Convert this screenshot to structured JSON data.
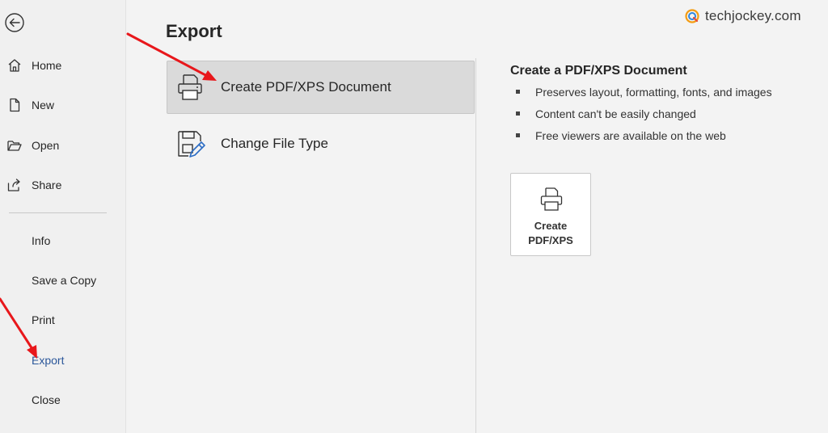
{
  "watermark": {
    "text": "techjockey.com"
  },
  "nav": {
    "back_icon": "back-arrow-icon",
    "items_top": [
      {
        "label": "Home",
        "icon": "home-icon"
      },
      {
        "label": "New",
        "icon": "new-document-icon"
      },
      {
        "label": "Open",
        "icon": "open-folder-icon"
      },
      {
        "label": "Share",
        "icon": "share-icon"
      }
    ],
    "items_bottom": [
      {
        "label": "Info"
      },
      {
        "label": "Save a Copy"
      },
      {
        "label": "Print"
      },
      {
        "label": "Export",
        "active": true
      },
      {
        "label": "Close"
      }
    ]
  },
  "main": {
    "title": "Export",
    "options": [
      {
        "label": "Create PDF/XPS Document",
        "icon": "pdf-document-icon",
        "selected": true
      },
      {
        "label": "Change File Type",
        "icon": "change-file-type-icon",
        "selected": false
      }
    ],
    "detail": {
      "title": "Create a PDF/XPS Document",
      "bullets": [
        "Preserves layout, formatting, fonts, and images",
        "Content can't be easily changed",
        "Free viewers are available on the web"
      ],
      "button_line1": "Create",
      "button_line2": "PDF/XPS"
    }
  },
  "colors": {
    "accent": "#2b579a",
    "annotation_arrow": "#e8171b"
  }
}
